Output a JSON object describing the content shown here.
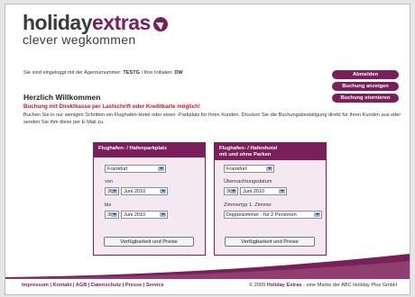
{
  "logo": {
    "part1": "holiday",
    "part2": "extras",
    "tagline": "clever wegkommen"
  },
  "login": {
    "prefix": "Sie sind eingeloggt mit der Agenturnummer:",
    "agency": "TESTG",
    "initials_label": "/ Ihre Initialen:",
    "initials": "DW"
  },
  "actions": {
    "logout": "Abmelden",
    "show_booking": "Buchung anzeigen",
    "cancel_booking": "Buchung stornieren"
  },
  "welcome": "Herzlich Willkommen",
  "promo": "Buchung mit Direktkasse per Lastschrift oder Kreditkarte möglich!",
  "intro": "Buchen Sie in nur wenigen Schritten ein Flughafen-Hotel oder einen -Parkplatz für Ihren Kunden. Drucken Sie die Buchungsbestätigung direkt für Ihren Kunden aus oder senden Sie ihm diese per E-Mail zu.",
  "parking": {
    "title": "Flughafen- / Hafenparkplatz",
    "airport": "Frankfurt",
    "from_label": "von",
    "from_day": "30",
    "from_month": "Juni 2010",
    "to_label": "bis",
    "to_day": "30",
    "to_month": "Juni 2010",
    "button": "Verfügbarkeit und Preise"
  },
  "hotel": {
    "title_line1": "Flughafen- / Hafenhotel",
    "title_line2": "mit und ohne Parken",
    "airport": "Frankfurt",
    "date_label": "Übernachtungsdatum",
    "day": "30",
    "month": "Juni 2010",
    "room_label": "Zimmertyp 1. Zimmer",
    "room": "Doppelzimmer - für 2 Personen",
    "button": "Verfügbarkeit und Preise"
  },
  "footer": {
    "links": "Impressum | Kontakt | AGB | Datenschutz | Presse | Service",
    "copy_prefix": "© 2009",
    "copy_brand": "Holiday Extras",
    "copy_suffix": "- eine Marke der ABC Holiday Plus GmbH"
  },
  "colors": {
    "brand": "#7a1f5c",
    "promo": "#c0182e",
    "box_bg": "#f5e9f1"
  }
}
